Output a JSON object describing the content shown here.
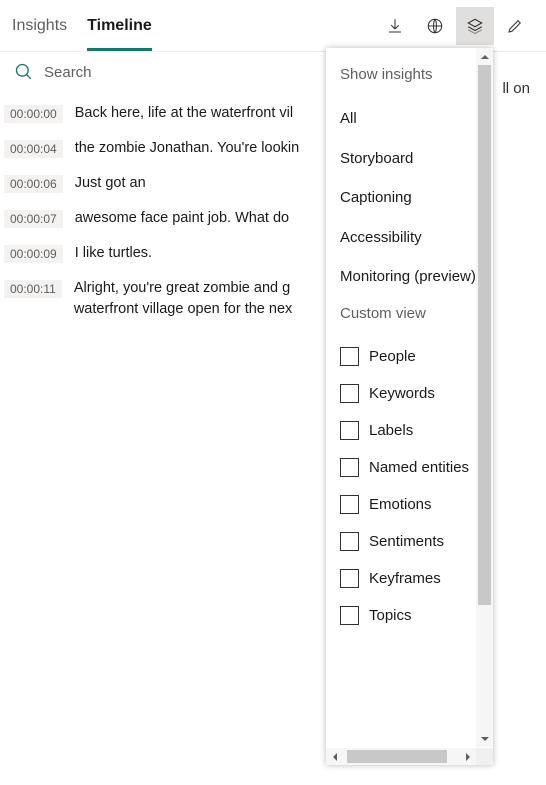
{
  "header": {
    "tabs": [
      {
        "label": "Insights",
        "active": false
      },
      {
        "label": "Timeline",
        "active": true
      }
    ],
    "toolbar": {
      "download": "download-icon",
      "globe": "globe-icon",
      "layers": "layers-icon",
      "edit": "edit-icon"
    }
  },
  "search": {
    "placeholder": "Search"
  },
  "right_fragment": "ll on",
  "transcript": [
    {
      "time": "00:00:00",
      "text": "Back here, life at the waterfront vil"
    },
    {
      "time": "00:00:04",
      "text": "the zombie Jonathan. You're lookin"
    },
    {
      "time": "00:00:06",
      "text": "Just got an"
    },
    {
      "time": "00:00:07",
      "text": "awesome face paint job. What do"
    },
    {
      "time": "00:00:09",
      "text": "I like turtles."
    },
    {
      "time": "00:00:11",
      "text": "Alright, you're great zombie and g\nwaterfront village open for the nex"
    }
  ],
  "panel": {
    "section_title": "Show insights",
    "items": [
      "All",
      "Storyboard",
      "Captioning",
      "Accessibility",
      "Monitoring (preview)"
    ],
    "custom_title": "Custom view",
    "custom_items": [
      "People",
      "Keywords",
      "Labels",
      "Named entities",
      "Emotions",
      "Sentiments",
      "Keyframes",
      "Topics"
    ]
  }
}
